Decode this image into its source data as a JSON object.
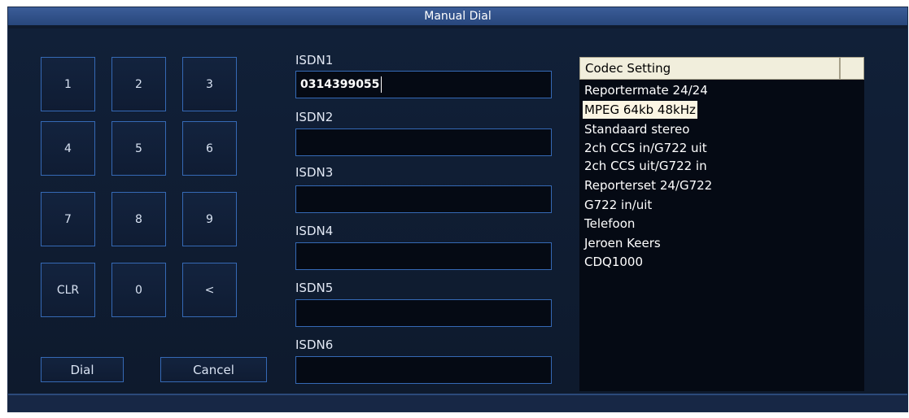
{
  "window": {
    "title": "Manual Dial"
  },
  "keypad": {
    "keys": [
      "1",
      "2",
      "3",
      "4",
      "5",
      "6",
      "7",
      "8",
      "9",
      "CLR",
      "0",
      "<"
    ]
  },
  "actions": {
    "dial_label": "Dial",
    "cancel_label": "Cancel"
  },
  "isdn": {
    "fields": [
      {
        "label": "ISDN1",
        "value": "0314399055"
      },
      {
        "label": "ISDN2",
        "value": ""
      },
      {
        "label": "ISDN3",
        "value": ""
      },
      {
        "label": "ISDN4",
        "value": ""
      },
      {
        "label": "ISDN5",
        "value": ""
      },
      {
        "label": "ISDN6",
        "value": ""
      }
    ]
  },
  "codec": {
    "header": "Codec Setting",
    "selected_index": 1,
    "items": [
      "Reportermate 24/24",
      "MPEG 64kb 48kHz",
      "Standaard stereo",
      "2ch CCS in/G722 uit",
      "2ch CCS uit/G722 in",
      "Reporterset 24/G722",
      "G722 in/uit",
      "Telefoon",
      "Jeroen Keers",
      "CDQ1000"
    ]
  },
  "colors": {
    "background": "#0f1a2e",
    "titlebar": "#28477c",
    "border_accent": "#3569b5",
    "field_bg": "#050a14",
    "selected_bg": "#fbf5e3"
  }
}
